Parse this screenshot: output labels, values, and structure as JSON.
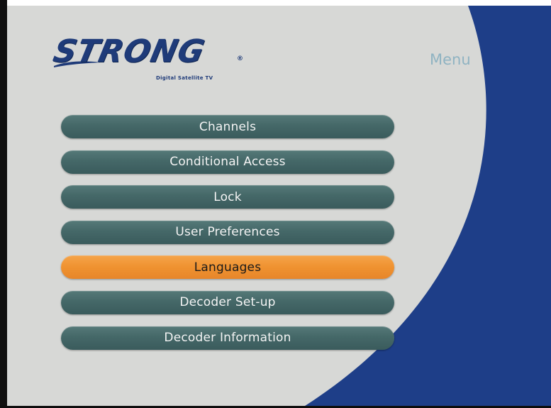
{
  "brand": {
    "logo_text": "STRONG",
    "registered_mark": "®",
    "tagline": "Digital Satellite TV"
  },
  "header": {
    "title": "Menu"
  },
  "menu": {
    "selected_index": 4,
    "items": [
      {
        "label": "Channels"
      },
      {
        "label": "Conditional Access"
      },
      {
        "label": "Lock"
      },
      {
        "label": "User Preferences"
      },
      {
        "label": "Languages"
      },
      {
        "label": "Decoder Set-up"
      },
      {
        "label": "Decoder Information"
      }
    ]
  },
  "colors": {
    "background": "#d7d8d6",
    "arc_blue": "#1e3e88",
    "item_normal": "#456868",
    "item_selected": "#ef9230",
    "title_text": "#8fb3c2",
    "logo": "#1f3b79"
  }
}
